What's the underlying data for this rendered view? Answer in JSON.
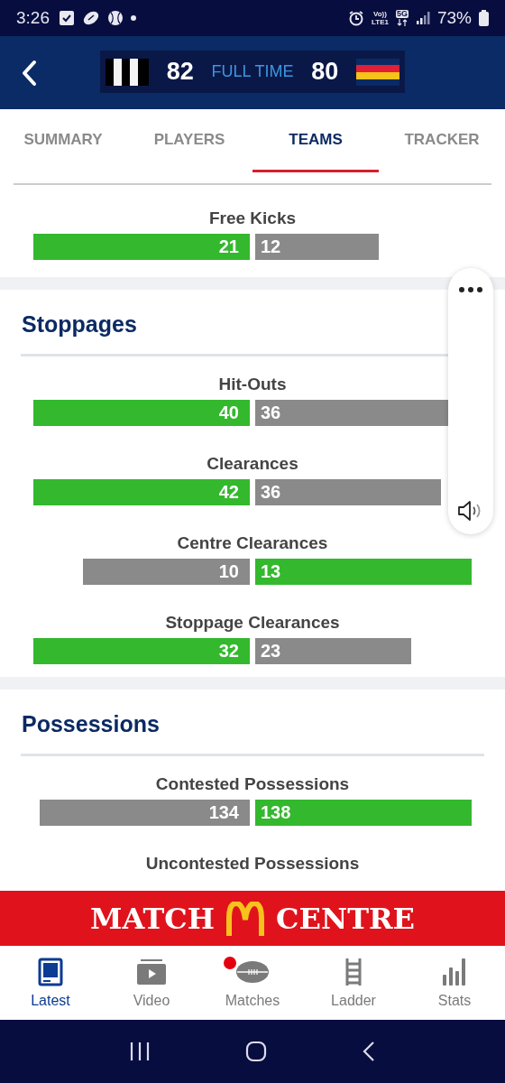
{
  "status_bar": {
    "time": "3:26",
    "volte": "Vo))",
    "lte": "LTE1",
    "network": "5G",
    "battery": "73%"
  },
  "header": {
    "home_score": "82",
    "status": "FULL TIME",
    "away_score": "80"
  },
  "tabs": [
    {
      "label": "SUMMARY",
      "selected": false
    },
    {
      "label": "PLAYERS",
      "selected": false
    },
    {
      "label": "TEAMS",
      "selected": true
    },
    {
      "label": "TRACKER",
      "selected": false
    }
  ],
  "sections": [
    {
      "stats": [
        {
          "label": "Free Kicks",
          "home": "21",
          "away": "12"
        }
      ]
    },
    {
      "title": "Stoppages",
      "stats": [
        {
          "label": "Hit-Outs",
          "home": "40",
          "away": "36"
        },
        {
          "label": "Clearances",
          "home": "42",
          "away": "36"
        },
        {
          "label": "Centre Clearances",
          "home": "10",
          "away": "13"
        },
        {
          "label": "Stoppage Clearances",
          "home": "32",
          "away": "23"
        }
      ]
    },
    {
      "title": "Possessions",
      "stats": [
        {
          "label": "Contested Possessions",
          "home": "134",
          "away": "138"
        },
        {
          "label": "Uncontested Possessions"
        }
      ]
    }
  ],
  "banner": {
    "left": "MATCH",
    "right": "CENTRE"
  },
  "nav": [
    {
      "label": "Latest",
      "selected": true,
      "badge": false
    },
    {
      "label": "Video",
      "selected": false,
      "badge": false
    },
    {
      "label": "Matches",
      "selected": false,
      "badge": true
    },
    {
      "label": "Ladder",
      "selected": false,
      "badge": false
    },
    {
      "label": "Stats",
      "selected": false,
      "badge": false
    }
  ]
}
